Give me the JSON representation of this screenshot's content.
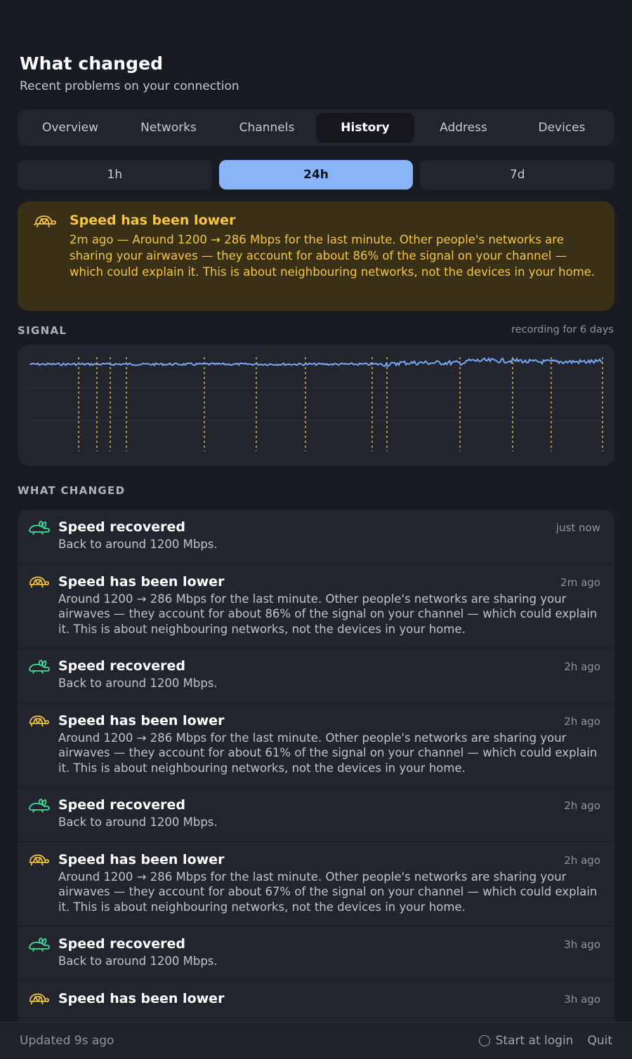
{
  "header": {
    "title": "What changed",
    "subtitle": "Recent problems on your connection"
  },
  "tabs": [
    {
      "label": "Overview",
      "active": false
    },
    {
      "label": "Networks",
      "active": false
    },
    {
      "label": "Channels",
      "active": false
    },
    {
      "label": "History",
      "active": true
    },
    {
      "label": "Address",
      "active": false
    },
    {
      "label": "Devices",
      "active": false
    }
  ],
  "ranges": [
    {
      "label": "1h",
      "active": false
    },
    {
      "label": "24h",
      "active": true
    },
    {
      "label": "7d",
      "active": false
    }
  ],
  "alert": {
    "icon": "turtle-icon",
    "title": "Speed has been lower",
    "body": "2m ago — Around 1200 → 286 Mbps for the last minute. Other people's networks are sharing your airwaves — they account for about 86% of the signal on your channel — which could explain it. This is about neighbouring networks, not the devices in your home."
  },
  "signal": {
    "label": "SIGNAL",
    "recording": "recording for 6 days"
  },
  "changes_label": "WHAT CHANGED",
  "events": [
    {
      "kind": "recovered",
      "icon": "rabbit-icon",
      "title": "Speed recovered",
      "body": "Back to around 1200 Mbps.",
      "time": "just now"
    },
    {
      "kind": "lower",
      "icon": "turtle-icon",
      "title": "Speed has been lower",
      "body": "Around 1200 → 286 Mbps for the last minute. Other people's networks are sharing your airwaves — they account for about 86% of the signal on your channel — which could explain it. This is about neighbouring networks, not the devices in your home.",
      "time": "2m ago"
    },
    {
      "kind": "recovered",
      "icon": "rabbit-icon",
      "title": "Speed recovered",
      "body": "Back to around 1200 Mbps.",
      "time": "2h ago"
    },
    {
      "kind": "lower",
      "icon": "turtle-icon",
      "title": "Speed has been lower",
      "body": "Around 1200 → 286 Mbps for the last minute. Other people's networks are sharing your airwaves — they account for about 61% of the signal on your channel — which could explain it. This is about neighbouring networks, not the devices in your home.",
      "time": "2h ago"
    },
    {
      "kind": "recovered",
      "icon": "rabbit-icon",
      "title": "Speed recovered",
      "body": "Back to around 1200 Mbps.",
      "time": "2h ago"
    },
    {
      "kind": "lower",
      "icon": "turtle-icon",
      "title": "Speed has been lower",
      "body": "Around 1200 → 286 Mbps for the last minute. Other people's networks are sharing your airwaves — they account for about 67% of the signal on your channel — which could explain it. This is about neighbouring networks, not the devices in your home.",
      "time": "2h ago"
    },
    {
      "kind": "recovered",
      "icon": "rabbit-icon",
      "title": "Speed recovered",
      "body": "Back to around 1200 Mbps.",
      "time": "3h ago"
    },
    {
      "kind": "lower",
      "icon": "turtle-icon",
      "title": "Speed has been lower",
      "body": "",
      "time": "3h ago"
    }
  ],
  "footer": {
    "updated": "Updated 9s ago",
    "login_label": "Start at login",
    "quit_label": "Quit"
  },
  "colors": {
    "accent": "#8ab4f8",
    "warning": "#f5c542",
    "recovered": "#3ddc97",
    "background": "#191b22",
    "card": "#22252e"
  }
}
